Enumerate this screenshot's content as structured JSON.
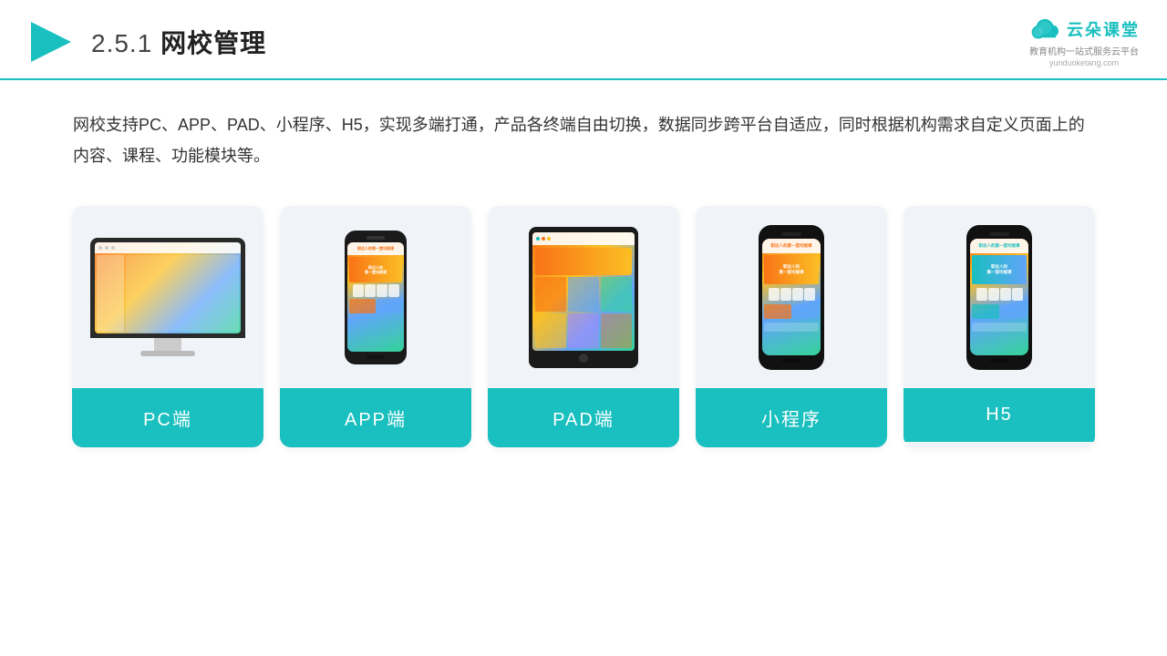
{
  "header": {
    "title_number": "2.5.1",
    "title_text": "网校管理",
    "logo_text": "云朵课堂",
    "logo_tagline": "教育机构一站\n式服务云平台",
    "logo_url": "yunduoketang.com"
  },
  "description": {
    "text": "网校支持PC、APP、PAD、小程序、H5，实现多端打通，产品各终端自由切换，数据同步跨平台自适应，同时根据机构需求自定义页面上的内容、课程、功能模块等。"
  },
  "cards": [
    {
      "label": "PC端",
      "type": "pc"
    },
    {
      "label": "APP端",
      "type": "phone"
    },
    {
      "label": "PAD端",
      "type": "tablet"
    },
    {
      "label": "小程序",
      "type": "phone2"
    },
    {
      "label": "H5",
      "type": "phone3"
    }
  ],
  "colors": {
    "accent": "#1ABFBF",
    "header_border": "#1ABFBF"
  }
}
